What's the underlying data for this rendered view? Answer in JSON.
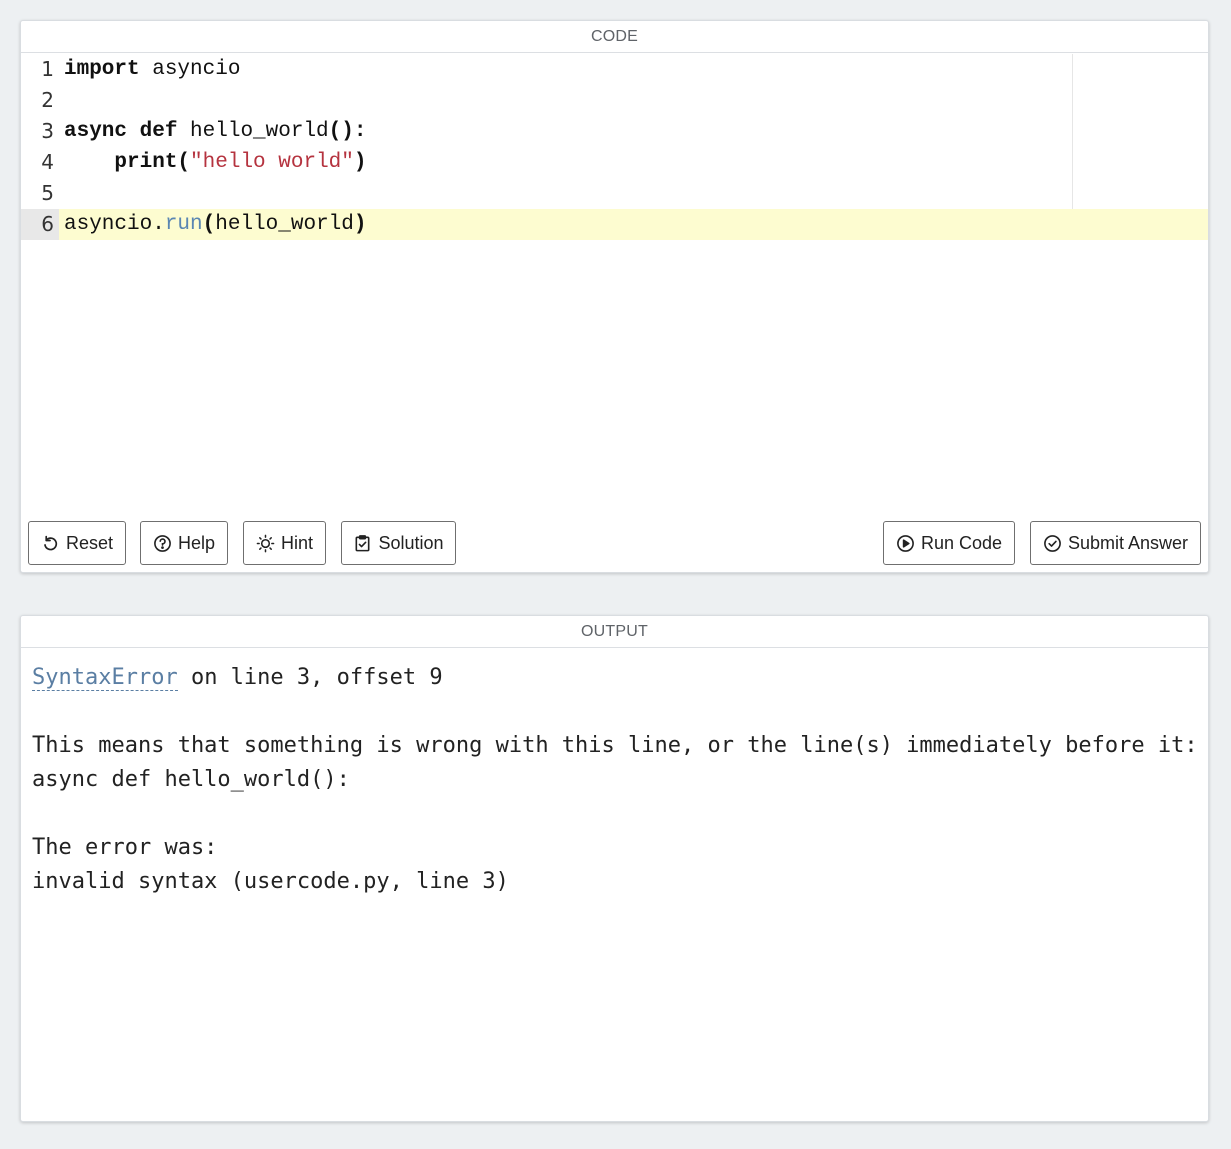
{
  "code_panel": {
    "title": "CODE",
    "lines": [
      {
        "num": "1",
        "parts": [
          {
            "t": "import",
            "k": "kw"
          },
          {
            "t": " asyncio",
            "k": ""
          }
        ]
      },
      {
        "num": "2",
        "parts": []
      },
      {
        "num": "3",
        "parts": [
          {
            "t": "async",
            "k": "kw"
          },
          {
            "t": " ",
            "k": ""
          },
          {
            "t": "def",
            "k": "kw"
          },
          {
            "t": " hello_world",
            "k": ""
          },
          {
            "t": "():",
            "k": "kw"
          }
        ]
      },
      {
        "num": "4",
        "parts": [
          {
            "t": "    ",
            "k": ""
          },
          {
            "t": "print(",
            "k": "kw"
          },
          {
            "t": "\"hello world\"",
            "k": "str"
          },
          {
            "t": ")",
            "k": "kw"
          }
        ]
      },
      {
        "num": "5",
        "parts": []
      },
      {
        "num": "6",
        "parts": [
          {
            "t": "asyncio.",
            "k": ""
          },
          {
            "t": "run",
            "k": "attr"
          },
          {
            "t": "(",
            "k": "kw"
          },
          {
            "t": "hello_world",
            "k": ""
          },
          {
            "t": ")",
            "k": "kw"
          }
        ]
      }
    ],
    "active_line": 6
  },
  "toolbar": {
    "reset_label": "Reset",
    "help_label": "Help",
    "hint_label": "Hint",
    "solution_label": "Solution",
    "run_label": "Run Code",
    "submit_label": "Submit Answer"
  },
  "icons": {
    "reset": "reset-icon",
    "help": "question-circle-icon",
    "hint": "lightbulb-sun-icon",
    "solution": "clipboard-check-icon",
    "run": "play-circle-icon",
    "submit": "check-circle-icon"
  },
  "output_panel": {
    "title": "OUTPUT",
    "error_name": "SyntaxError",
    "error_location": " on line 3, offset 9",
    "explanation": "This means that something is wrong with this line, or the line(s) immediately before it:",
    "offending_line": "async def hello_world():",
    "error_was_label": "The error was:",
    "error_message": "invalid syntax (usercode.py, line 3)"
  }
}
